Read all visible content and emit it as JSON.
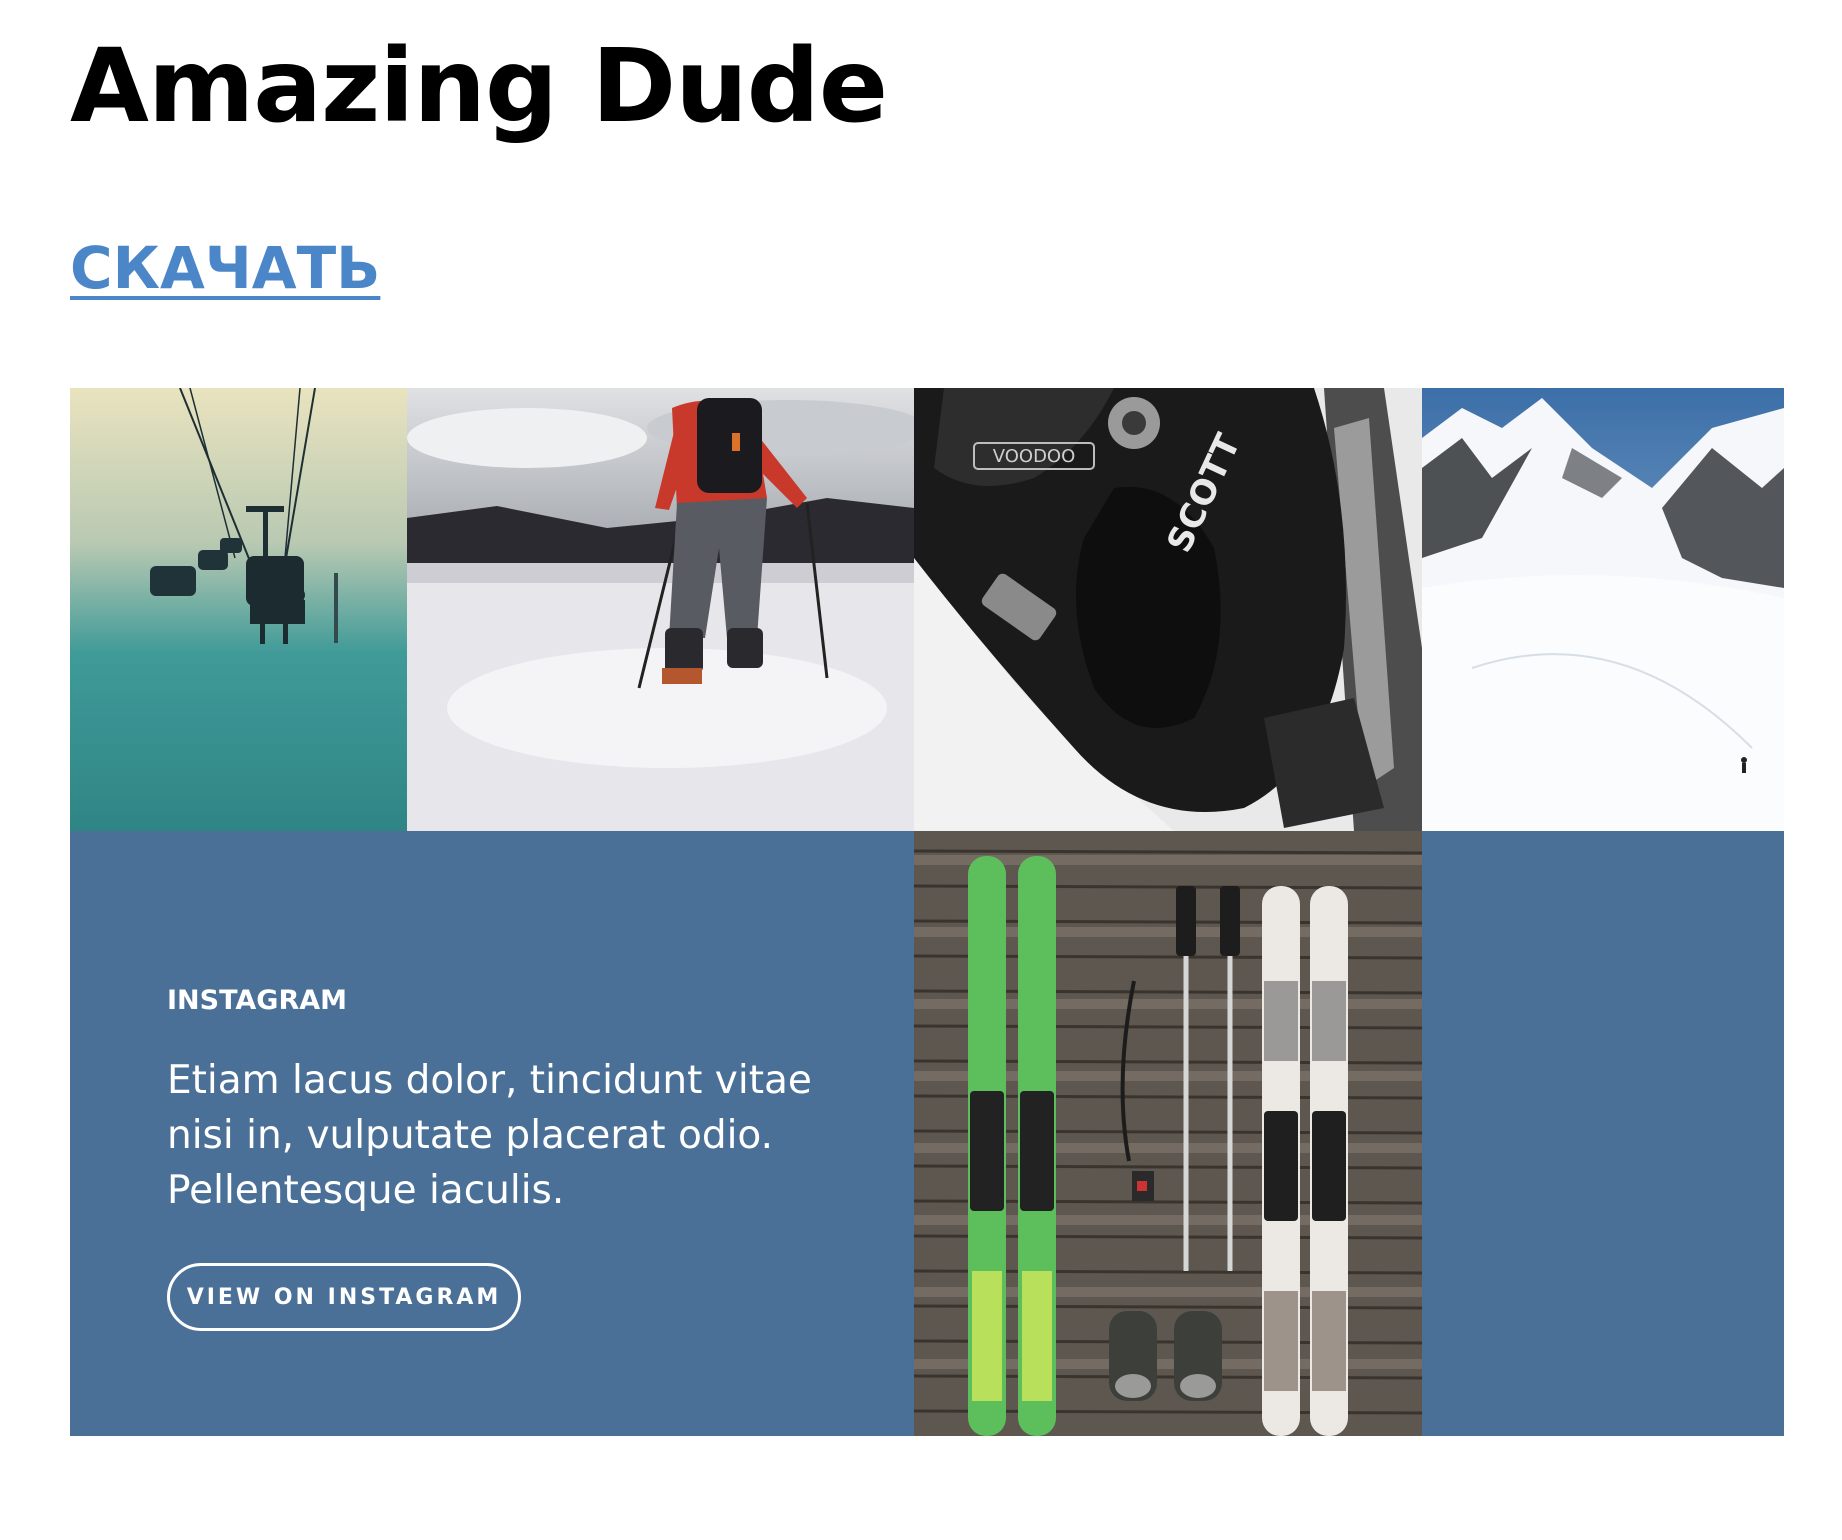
{
  "header": {
    "title": "Amazing Dude",
    "download_label": "СКАЧАТЬ"
  },
  "gallery": {
    "photos": [
      {
        "subject": "chairlift-photo"
      },
      {
        "subject": "snowshoe-hiker-photo"
      },
      {
        "subject": "ski-boot-photo"
      },
      {
        "subject": "snowy-mountain-photo"
      },
      {
        "subject": "skis-and-poles-photo"
      }
    ],
    "boot_brand_text": "VOODOO",
    "boot_logo_text": "SCOTT"
  },
  "instagram": {
    "label": "INSTAGRAM",
    "text": "Etiam lacus dolor, tincidunt vitae nisi in, vulputate placerat odio. Pellentesque iaculis.",
    "button_label": "VIEW ON INSTAGRAM"
  },
  "colors": {
    "link": "#4a86c8",
    "panel": "#4a7098"
  }
}
